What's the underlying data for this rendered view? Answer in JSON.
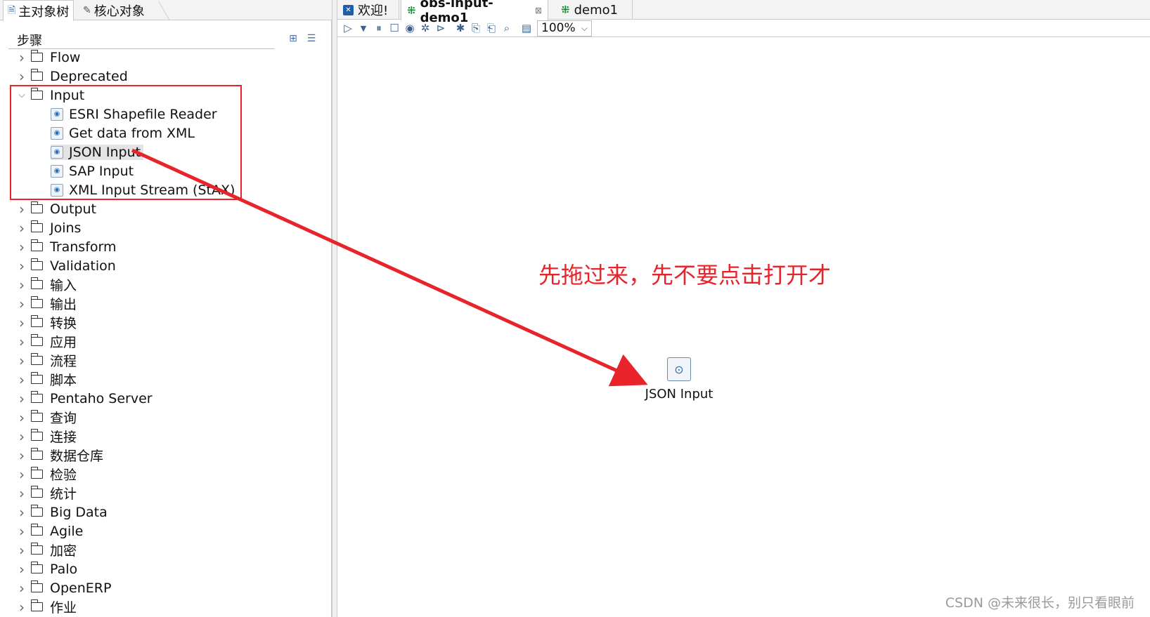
{
  "left_panel": {
    "tabs": [
      {
        "label": "主对象树",
        "icon": "document-icon"
      },
      {
        "label": "核心对象",
        "icon": "pencil-icon"
      }
    ],
    "search": {
      "label": "步骤",
      "value": ""
    },
    "tree": [
      {
        "label": "Flow",
        "expanded": false
      },
      {
        "label": "Deprecated",
        "expanded": false
      },
      {
        "label": "Input",
        "expanded": true,
        "children": [
          {
            "label": "ESRI Shapefile Reader"
          },
          {
            "label": "Get data from XML"
          },
          {
            "label": "JSON Input",
            "selected": true
          },
          {
            "label": "SAP Input"
          },
          {
            "label": "XML Input Stream (StAX)"
          }
        ]
      },
      {
        "label": "Output"
      },
      {
        "label": "Joins"
      },
      {
        "label": "Transform"
      },
      {
        "label": "Validation"
      },
      {
        "label": "输入"
      },
      {
        "label": "输出"
      },
      {
        "label": "转换"
      },
      {
        "label": "应用"
      },
      {
        "label": "流程"
      },
      {
        "label": "脚本"
      },
      {
        "label": "Pentaho Server"
      },
      {
        "label": "查询"
      },
      {
        "label": "连接"
      },
      {
        "label": "数据仓库"
      },
      {
        "label": "检验"
      },
      {
        "label": "统计"
      },
      {
        "label": "Big Data"
      },
      {
        "label": "Agile"
      },
      {
        "label": "加密"
      },
      {
        "label": "Palo"
      },
      {
        "label": "OpenERP"
      },
      {
        "label": "作业"
      }
    ]
  },
  "editor": {
    "tabs": [
      {
        "label": "欢迎!",
        "icon": "welcome-icon"
      },
      {
        "label": "obs-input-demo1",
        "icon": "transformation-icon",
        "active": true,
        "close": "⊠"
      },
      {
        "label": "demo1",
        "icon": "transformation-icon"
      }
    ],
    "zoom": "100%",
    "annotation": "先拖过来，先不要点击打开才",
    "node_label": "JSON Input",
    "watermark": "CSDN @未来很长，别只看眼前"
  },
  "colors": {
    "annotation_red": "#e8232a",
    "accent_blue": "#1f5fa8",
    "accent_green": "#1d8a3e"
  }
}
